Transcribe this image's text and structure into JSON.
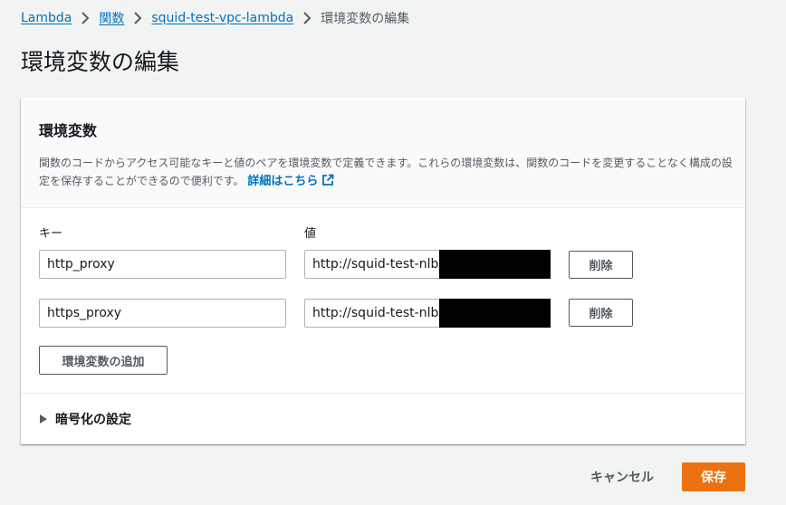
{
  "breadcrumb": {
    "items": [
      "Lambda",
      "関数",
      "squid-test-vpc-lambda"
    ],
    "current": "環境変数の編集"
  },
  "page": {
    "title": "環境変数の編集"
  },
  "panel": {
    "title": "環境変数",
    "description": "関数のコードからアクセス可能なキーと値のペアを環境変数で定義できます。これらの環境変数は、関数のコードを変更することなく構成の設定を保存することができるので便利です。",
    "learn_more": "詳細はこちら",
    "key_label": "キー",
    "value_label": "値",
    "variables": [
      {
        "key": "http_proxy",
        "value": "http://squid-test-nlb-1",
        "remove_label": "削除"
      },
      {
        "key": "https_proxy",
        "value": "http://squid-test-nlb-",
        "remove_label": "削除"
      }
    ],
    "add_label": "環境変数の追加",
    "encryption_label": "暗号化の設定"
  },
  "footer": {
    "cancel_label": "キャンセル",
    "save_label": "保存"
  },
  "colors": {
    "link": "#0073bb",
    "primary": "#ec7211",
    "background": "#f2f3f3",
    "text": "#16191f",
    "secondary_text": "#545b64"
  },
  "icons": [
    "chevron-right-icon",
    "external-link-icon",
    "caret-right-icon"
  ]
}
